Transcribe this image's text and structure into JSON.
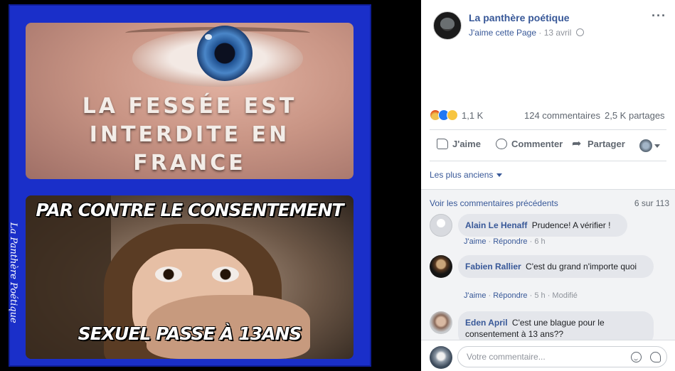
{
  "image": {
    "top_caption": [
      "LA FESSÉE EST",
      "INTERDITE EN",
      "FRANCE"
    ],
    "bottom_caption_top": "PAR CONTRE LE CONSENTEMENT",
    "bottom_caption_bottom": "SEXUEL PASSE À 13ANS",
    "watermark": "La Panthère Poétique",
    "colors": {
      "frame": "#1a2fc9"
    }
  },
  "post": {
    "page_name": "La panthère poétique",
    "like_page_label": "J'aime cette Page",
    "separator": "·",
    "date": "13 avril",
    "privacy_icon": "globe-icon",
    "more_label": "···",
    "reactions": {
      "icons": [
        "angry-icon",
        "like-icon",
        "sad-icon"
      ],
      "count": "1,1 K",
      "comments": "124 commentaires",
      "shares": "2,5 K partages"
    },
    "actions": {
      "like": "J'aime",
      "comment": "Commenter",
      "share": "Partager"
    },
    "sort_label": "Les plus anciens",
    "view_previous": "Voir les commentaires précédents",
    "comment_counter": "6 sur 113",
    "comments": [
      {
        "author": "Alain Le Henaff",
        "text": "Prudence! A vérifier !",
        "like": "J'aime",
        "reply": "Répondre",
        "time": "6 h",
        "edited": ""
      },
      {
        "author": "Fabien Rallier",
        "text": "C'est du grand n'importe quoi",
        "like": "J'aime",
        "reply": "Répondre",
        "time": "5 h",
        "edited": "Modifié"
      },
      {
        "author": "Eden April",
        "text": "C'est une blague pour le consentement à 13 ans??"
      }
    ],
    "composer_placeholder": "Votre commentaire...",
    "colors": {
      "link": "#385898",
      "muted": "#90949c",
      "bubble": "#e4e6eb"
    }
  }
}
